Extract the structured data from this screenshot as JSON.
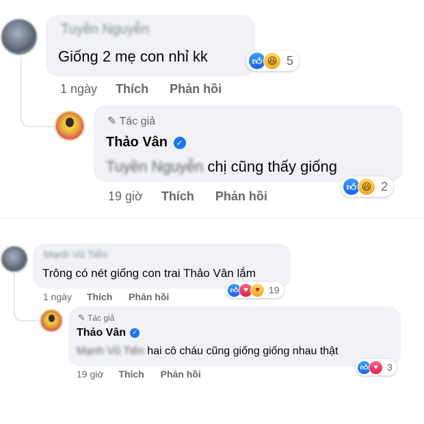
{
  "shot1": {
    "comment": {
      "author_name": "Tuyền Nguyễn",
      "text": "Giống 2 mẹ con nhỉ kk",
      "time": "1 ngày",
      "like_action": "Thích",
      "reply_action": "Phản hồi",
      "reactions": {
        "icons": [
          "like-icon",
          "haha-icon"
        ],
        "count": "5"
      }
    },
    "reply": {
      "author_badge": "Tác giả",
      "author_name": "Thảo Vân",
      "verified_mark": "✓",
      "mention": "Tuyền Nguyễn",
      "text": "chị cũng thấy giống",
      "time": "19 giờ",
      "like_action": "Thích",
      "reply_action": "Phản hồi",
      "reactions": {
        "icons": [
          "like-icon",
          "haha-icon"
        ],
        "count": "2"
      }
    }
  },
  "shot2": {
    "comment": {
      "author_name": "Mạnh Vũ Tiến",
      "text": "Trông có nét giống con trai Thảo Vân lắm",
      "time": "1 ngày",
      "like_action": "Thích",
      "reply_action": "Phản hồi",
      "reactions": {
        "icons": [
          "like-icon",
          "love-icon",
          "care-icon"
        ],
        "count": "19"
      }
    },
    "reply": {
      "author_badge": "Tác giả",
      "author_name": "Thảo Vân",
      "verified_mark": "✓",
      "mention": "Mạnh Vũ Tiến",
      "text": "hai cô cháu cũng giống giống nhau thật",
      "time": "19 giờ",
      "like_action": "Thích",
      "reply_action": "Phản hồi",
      "reactions": {
        "icons": [
          "like-icon",
          "love-icon"
        ],
        "count": "3"
      }
    }
  },
  "colors": {
    "bubble": "#f0f2f5",
    "meta": "#65676b",
    "verified": "#1877f2",
    "text": "#050505"
  }
}
